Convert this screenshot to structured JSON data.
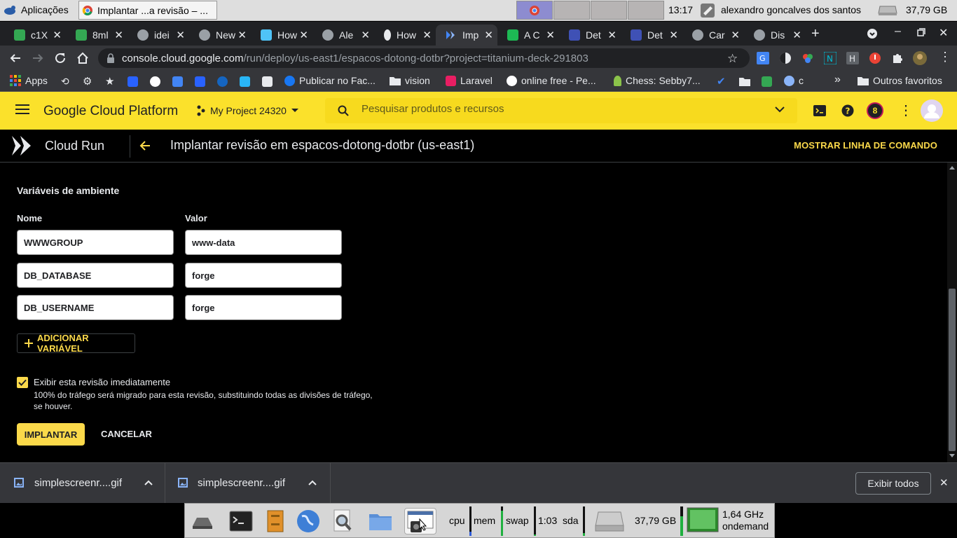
{
  "desktop": {
    "apps_menu": "Aplicações",
    "task_title": "Implantar ...a revisão – ...",
    "clock": "13:17",
    "user": "alexandro goncalves dos santos",
    "disk": "37,79 GB"
  },
  "browser": {
    "tabs": [
      {
        "label": "c1X",
        "color": "#34a853"
      },
      {
        "label": "8ml",
        "color": "#34a853"
      },
      {
        "label": "idei",
        "color": "#9aa0a6"
      },
      {
        "label": "New",
        "color": "#9aa0a6"
      },
      {
        "label": "How",
        "color": "#4fc3f7"
      },
      {
        "label": "Ale",
        "color": "#9aa0a6"
      },
      {
        "label": "How",
        "color": "#e8eaed"
      },
      {
        "label": "Imp",
        "color": "#4285f4"
      },
      {
        "label": "A C",
        "color": "#1db954"
      },
      {
        "label": "Det",
        "color": "#3f51b5"
      },
      {
        "label": "Det",
        "color": "#3f51b5"
      },
      {
        "label": "Car",
        "color": "#9aa0a6"
      },
      {
        "label": "Dis",
        "color": "#9aa0a6"
      }
    ],
    "url_host": "console.cloud.google.com",
    "url_path": "/run/deploy/us-east1/espacos-dotong-dotbr?project=titanium-deck-291803",
    "bookmarks": [
      {
        "label": "Apps"
      },
      {
        "label": "Publicar no Fac..."
      },
      {
        "label": "vision"
      },
      {
        "label": "Laravel"
      },
      {
        "label": "online free - Pe..."
      },
      {
        "label": "Chess: Sebby7..."
      },
      {
        "label": "c"
      }
    ],
    "other_bookmarks": "Outros favoritos"
  },
  "gcp": {
    "brand": "Google Cloud Platform",
    "project": "My Project 24320",
    "search_placeholder": "Pesquisar produtos e recursos",
    "notif_count": "8",
    "product": "Cloud Run",
    "page_title": "Implantar revisão em espacos-dotong-dotbr (us-east1)",
    "show_cmd": "MOSTRAR LINHA DE COMANDO"
  },
  "form": {
    "section_title": "Variáveis de ambiente",
    "col_name": "Nome",
    "col_value": "Valor",
    "vars": [
      {
        "name": "WWWGROUP",
        "value": "www-data"
      },
      {
        "name": "DB_DATABASE",
        "value": "forge"
      },
      {
        "name": "DB_USERNAME",
        "value": "forge"
      }
    ],
    "add_var": "ADICIONAR VARIÁVEL",
    "serve_label": "Exibir esta revisão imediatamente",
    "serve_desc": "100% do tráfego será migrado para esta revisão, substituindo todas as divisões de tráfego, se houver.",
    "deploy": "IMPLANTAR",
    "cancel": "CANCELAR"
  },
  "downloads": {
    "items": [
      {
        "name": "simplescreenr....gif"
      },
      {
        "name": "simplescreenr....gif"
      }
    ],
    "show_all": "Exibir todos"
  },
  "taskbar": {
    "cpu": "cpu",
    "mem": "mem",
    "swap": "swap",
    "uptime": "1:03",
    "sda": "sda",
    "disk": "37,79 GB",
    "freq": "1,64 GHz",
    "governor": "ondemand"
  }
}
